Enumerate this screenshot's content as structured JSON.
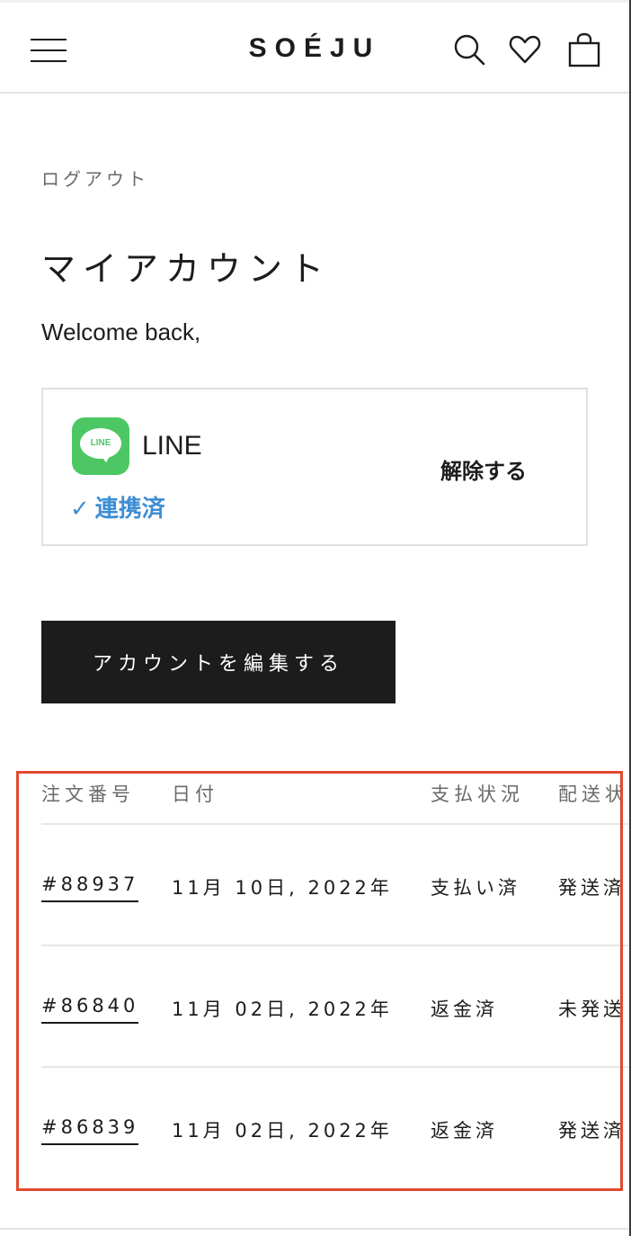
{
  "header": {
    "logo": "SOÉJU",
    "icons": [
      "menu-icon",
      "search-icon",
      "heart-icon",
      "bag-icon"
    ]
  },
  "account": {
    "logout_label": "ログアウト",
    "title": "マイアカウント",
    "welcome": "Welcome back,"
  },
  "line": {
    "logo_text": "LINE",
    "name": "LINE",
    "linked_check": "✓",
    "linked_label": "連携済",
    "unlink_label": "解除する"
  },
  "edit_button": "アカウントを編集する",
  "orders": {
    "headers": [
      "注文番号",
      "日付",
      "支払状況",
      "配送状況"
    ],
    "rows": [
      {
        "number": "#88937",
        "date": "11月 10日, 2022年",
        "payment": "支払い済",
        "shipping": "発送済"
      },
      {
        "number": "#86840",
        "date": "11月 02日, 2022年",
        "payment": "返金済",
        "shipping": "未発送"
      },
      {
        "number": "#86839",
        "date": "11月 02日, 2022年",
        "payment": "返金済",
        "shipping": "発送済"
      }
    ]
  },
  "colors": {
    "accent_line_green": "#4cc764",
    "linked_blue": "#3d8ed4",
    "button_dark": "#1c1c1c",
    "highlight_red": "#e14b2f"
  }
}
